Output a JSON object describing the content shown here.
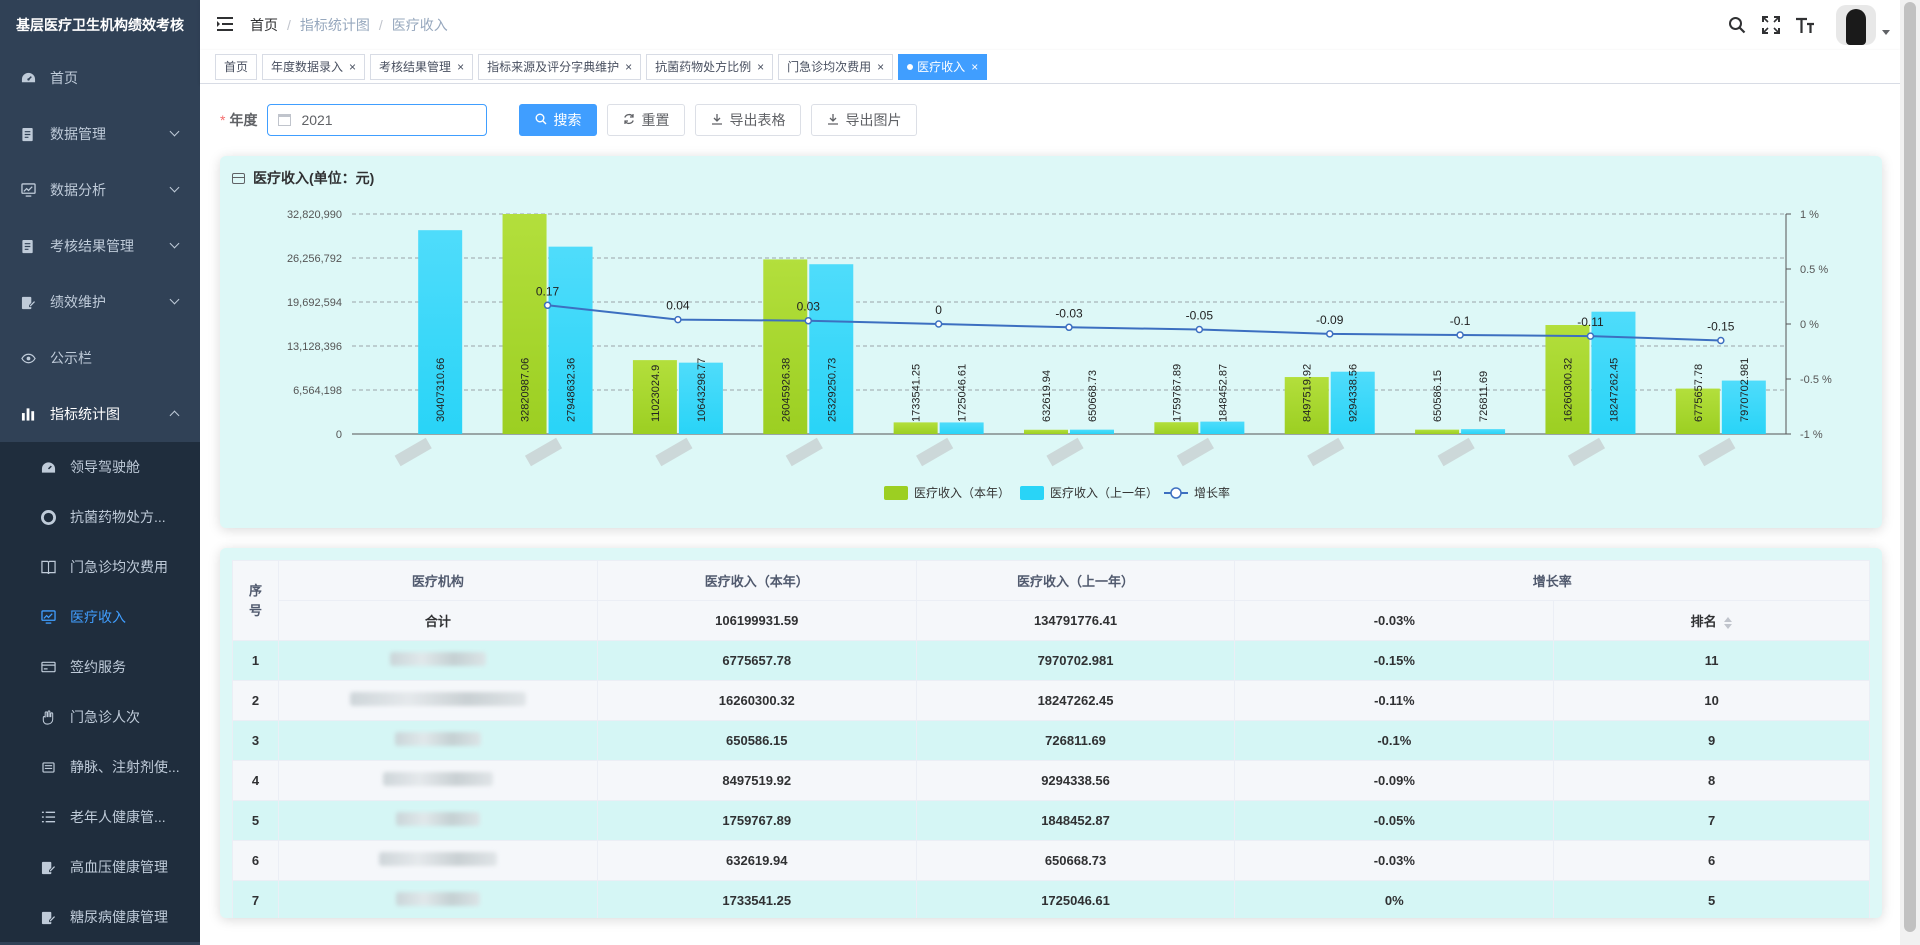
{
  "app": {
    "title": "基层医疗卫生机构绩效考核"
  },
  "sidebar": {
    "items": [
      {
        "label": "首页",
        "icon": "dashboard-icon"
      },
      {
        "label": "数据管理",
        "icon": "document-icon"
      },
      {
        "label": "数据分析",
        "icon": "monitor-icon"
      },
      {
        "label": "考核结果管理",
        "icon": "document-icon"
      },
      {
        "label": "绩效维护",
        "icon": "edit-icon"
      },
      {
        "label": "公示栏",
        "icon": "eye-icon"
      },
      {
        "label": "指标统计图",
        "icon": "bar-chart-icon"
      }
    ],
    "subitems": [
      {
        "label": "领导驾驶舱",
        "icon": "dashboard-icon"
      },
      {
        "label": "抗菌药物处方...",
        "icon": "lifebuoy-icon"
      },
      {
        "label": "门急诊均次费用",
        "icon": "book-icon"
      },
      {
        "label": "医疗收入",
        "icon": "monitor-icon"
      },
      {
        "label": "签约服务",
        "icon": "card-icon"
      },
      {
        "label": "门急诊人次",
        "icon": "hand-icon"
      },
      {
        "label": "静脉、注射剂使...",
        "icon": "syringe-icon"
      },
      {
        "label": "老年人健康管...",
        "icon": "list-icon"
      },
      {
        "label": "高血压健康管理",
        "icon": "edit-icon"
      },
      {
        "label": "糖尿病健康管理",
        "icon": "edit-icon"
      }
    ]
  },
  "navbar": {
    "breadcrumb": [
      "首页",
      "指标统计图",
      "医疗收入"
    ]
  },
  "tags": [
    {
      "label": "首页",
      "closable": false,
      "active": false
    },
    {
      "label": "年度数据录入",
      "closable": true,
      "active": false
    },
    {
      "label": "考核结果管理",
      "closable": true,
      "active": false
    },
    {
      "label": "指标来源及评分字典维护",
      "closable": true,
      "active": false
    },
    {
      "label": "抗菌药物处方比例",
      "closable": true,
      "active": false
    },
    {
      "label": "门急诊均次费用",
      "closable": true,
      "active": false
    },
    {
      "label": "医疗收入",
      "closable": true,
      "active": true
    }
  ],
  "tag_close_glyph": "×",
  "form": {
    "year_label": "年度",
    "required_mark": "*",
    "year_value": "2021",
    "search_label": "搜索",
    "reset_label": "重置",
    "export_table_label": "导出表格",
    "export_image_label": "导出图片"
  },
  "chart_card": {
    "title": "医疗收入(单位：元)"
  },
  "colors": {
    "current_year_bar": "#9ccf22",
    "last_year_bar": "#29d4f7",
    "growth_line": "#3c6fc0",
    "active": "#409eff",
    "sidebar_bg": "#304156"
  },
  "chart_data": {
    "type": "bar",
    "y_left": {
      "ticks": [
        "0",
        "6,564,198",
        "13,128,396",
        "19,692,594",
        "26,256,792",
        "32,820,990"
      ],
      "max": 32820990
    },
    "y_right": {
      "ticks": [
        "-1 %",
        "-0.5 %",
        "0 %",
        "0.5 %",
        "1 %"
      ],
      "min": -1,
      "max": 1
    },
    "categories_count": 11,
    "series": [
      {
        "name": "医疗收入（本年）",
        "values": [
          null,
          32820987.06,
          11023024.9,
          26045926.38,
          1733541.25,
          632619.94,
          1759767.89,
          8497519.92,
          650586.15,
          16260300.32,
          6775657.78
        ],
        "labels": [
          null,
          "32820987.06",
          "11023024.9",
          "26045926.38",
          "1733541.25",
          "632619.94",
          "1759767.89",
          "8497519.92",
          "650586.15",
          "16260300.32",
          "6775657.78"
        ]
      },
      {
        "name": "医疗收入（上一年）",
        "values": [
          30407310.66,
          27948632.36,
          10643298.77,
          25329250.73,
          1725046.61,
          650668.73,
          1848452.87,
          9294338.56,
          726811.69,
          18247262.45,
          7970702.981
        ],
        "labels": [
          "30407310.66",
          "27948632.36",
          "10643298.77",
          "25329250.73",
          "1725046.61",
          "650668.73",
          "1848452.87",
          "9294338.56",
          "726811.69",
          "18247262.45",
          "7970702.981"
        ]
      },
      {
        "name": "增长率",
        "values": [
          null,
          0.17,
          0.04,
          0.03,
          0,
          -0.03,
          -0.05,
          -0.09,
          -0.1,
          -0.11,
          -0.15
        ],
        "labels": [
          null,
          "0.17",
          "0.04",
          "0.03",
          "0",
          "-0.03",
          "-0.05",
          "-0.09",
          "-0.1",
          "-0.11",
          "-0.15"
        ]
      }
    ],
    "legend_position": "bottom-center",
    "grid": true
  },
  "table": {
    "headers": {
      "index": "序号",
      "org": "医疗机构",
      "current": "医疗收入（本年）",
      "last": "医疗收入（上一年）",
      "growth": "增长率",
      "rank": "排名"
    },
    "summary": {
      "label": "合计",
      "current": "106199931.59",
      "last": "134791776.41",
      "growth": "-0.03%"
    },
    "rows": [
      {
        "index": "1",
        "current": "6775657.78",
        "last": "7970702.981",
        "growth": "-0.15%",
        "rank": "11"
      },
      {
        "index": "2",
        "current": "16260300.32",
        "last": "18247262.45",
        "growth": "-0.11%",
        "rank": "10"
      },
      {
        "index": "3",
        "current": "650586.15",
        "last": "726811.69",
        "growth": "-0.1%",
        "rank": "9"
      },
      {
        "index": "4",
        "current": "8497519.92",
        "last": "9294338.56",
        "growth": "-0.09%",
        "rank": "8"
      },
      {
        "index": "5",
        "current": "1759767.89",
        "last": "1848452.87",
        "growth": "-0.05%",
        "rank": "7"
      },
      {
        "index": "6",
        "current": "632619.94",
        "last": "650668.73",
        "growth": "-0.03%",
        "rank": "6"
      },
      {
        "index": "7",
        "current": "1733541.25",
        "last": "1725046.61",
        "growth": "0%",
        "rank": "5"
      }
    ]
  }
}
